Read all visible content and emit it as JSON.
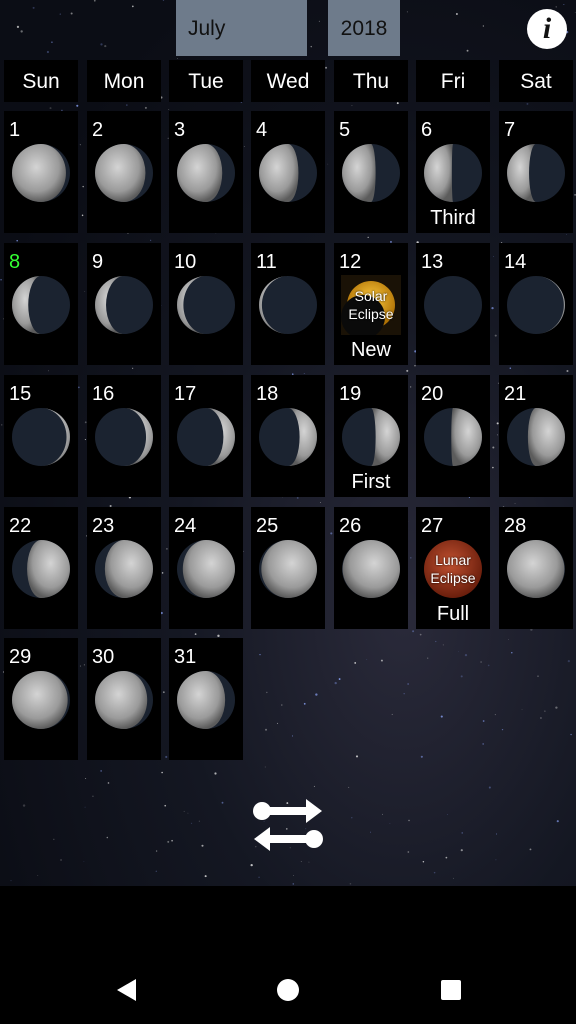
{
  "header": {
    "month": "July",
    "year": "2018",
    "info_icon": "info-icon"
  },
  "weekdays": [
    "Sun",
    "Mon",
    "Tue",
    "Wed",
    "Thu",
    "Fri",
    "Sat"
  ],
  "first_weekday": 0,
  "today": 8,
  "colors": {
    "today": "#33ff33",
    "selector": "#6e7b8b",
    "solar": "#f0a000",
    "lunar": "#b0401c"
  },
  "days": [
    {
      "d": "1",
      "f": 0.93,
      "side": "left"
    },
    {
      "d": "2",
      "f": 0.87,
      "side": "left"
    },
    {
      "d": "3",
      "f": 0.78,
      "side": "left"
    },
    {
      "d": "4",
      "f": 0.68,
      "side": "left"
    },
    {
      "d": "5",
      "f": 0.58,
      "side": "left"
    },
    {
      "d": "6",
      "f": 0.48,
      "side": "left",
      "label": "Third"
    },
    {
      "d": "7",
      "f": 0.38,
      "side": "left"
    },
    {
      "d": "8",
      "f": 0.28,
      "side": "left"
    },
    {
      "d": "9",
      "f": 0.19,
      "side": "left"
    },
    {
      "d": "10",
      "f": 0.11,
      "side": "left"
    },
    {
      "d": "11",
      "f": 0.05,
      "side": "left"
    },
    {
      "d": "12",
      "f": 0.0,
      "side": "left",
      "label": "New",
      "eclipse": "Solar Eclipse"
    },
    {
      "d": "13",
      "f": 0.0,
      "side": "right"
    },
    {
      "d": "14",
      "f": 0.02,
      "side": "right"
    },
    {
      "d": "15",
      "f": 0.06,
      "side": "right"
    },
    {
      "d": "16",
      "f": 0.12,
      "side": "right"
    },
    {
      "d": "17",
      "f": 0.2,
      "side": "right"
    },
    {
      "d": "18",
      "f": 0.3,
      "side": "right"
    },
    {
      "d": "19",
      "f": 0.42,
      "side": "right",
      "label": "First"
    },
    {
      "d": "20",
      "f": 0.53,
      "side": "right"
    },
    {
      "d": "21",
      "f": 0.64,
      "side": "right"
    },
    {
      "d": "22",
      "f": 0.74,
      "side": "right"
    },
    {
      "d": "23",
      "f": 0.83,
      "side": "right"
    },
    {
      "d": "24",
      "f": 0.9,
      "side": "right"
    },
    {
      "d": "25",
      "f": 0.96,
      "side": "right"
    },
    {
      "d": "26",
      "f": 0.99,
      "side": "right"
    },
    {
      "d": "27",
      "f": 1.0,
      "side": "right",
      "label": "Full",
      "eclipse": "Lunar Eclipse"
    },
    {
      "d": "28",
      "f": 0.99,
      "side": "left"
    },
    {
      "d": "29",
      "f": 0.96,
      "side": "left"
    },
    {
      "d": "30",
      "f": 0.9,
      "side": "left"
    },
    {
      "d": "31",
      "f": 0.83,
      "side": "left"
    }
  ],
  "footer": {
    "swap_icon": "swap-arrows-icon"
  },
  "navbar": {
    "back": "back-icon",
    "home": "home-icon",
    "recents": "recents-icon"
  }
}
